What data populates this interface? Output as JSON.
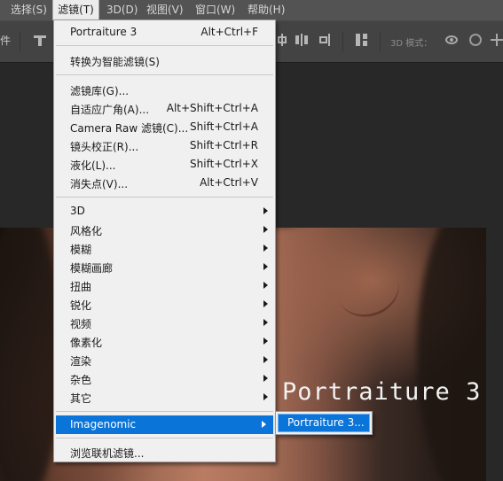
{
  "menubar": {
    "items": [
      {
        "label": "选择(S)"
      },
      {
        "label": "滤镜(T)"
      },
      {
        "label": "3D(D)"
      },
      {
        "label": "视图(V)"
      },
      {
        "label": "窗口(W)"
      },
      {
        "label": "帮助(H)"
      }
    ],
    "left_partial": "件"
  },
  "optionsbar": {
    "mode_label": "3D 模式："
  },
  "filter_menu": {
    "items": [
      {
        "label": "Portraiture 3",
        "shortcut": "Alt+Ctrl+F"
      },
      {
        "label": "转换为智能滤镜(S)"
      },
      {
        "label": "滤镜库(G)..."
      },
      {
        "label": "自适应广角(A)...",
        "shortcut": "Alt+Shift+Ctrl+A"
      },
      {
        "label": "Camera Raw 滤镜(C)...",
        "shortcut": "Shift+Ctrl+A"
      },
      {
        "label": "镜头校正(R)...",
        "shortcut": "Shift+Ctrl+R"
      },
      {
        "label": "液化(L)...",
        "shortcut": "Shift+Ctrl+X"
      },
      {
        "label": "消失点(V)...",
        "shortcut": "Alt+Ctrl+V"
      },
      {
        "label": "3D"
      },
      {
        "label": "风格化"
      },
      {
        "label": "模糊"
      },
      {
        "label": "模糊画廊"
      },
      {
        "label": "扭曲"
      },
      {
        "label": "锐化"
      },
      {
        "label": "视频"
      },
      {
        "label": "像素化"
      },
      {
        "label": "渲染"
      },
      {
        "label": "杂色"
      },
      {
        "label": "其它"
      },
      {
        "label": "Imagenomic"
      },
      {
        "label": "浏览联机滤镜..."
      }
    ]
  },
  "submenu": {
    "item": "Portraiture 3..."
  },
  "canvas": {
    "overlay_text": "Portraiture 3"
  },
  "colors": {
    "highlight": "#0a74d8",
    "menubar_bg": "#535353",
    "menu_bg": "#f0f0f0"
  }
}
